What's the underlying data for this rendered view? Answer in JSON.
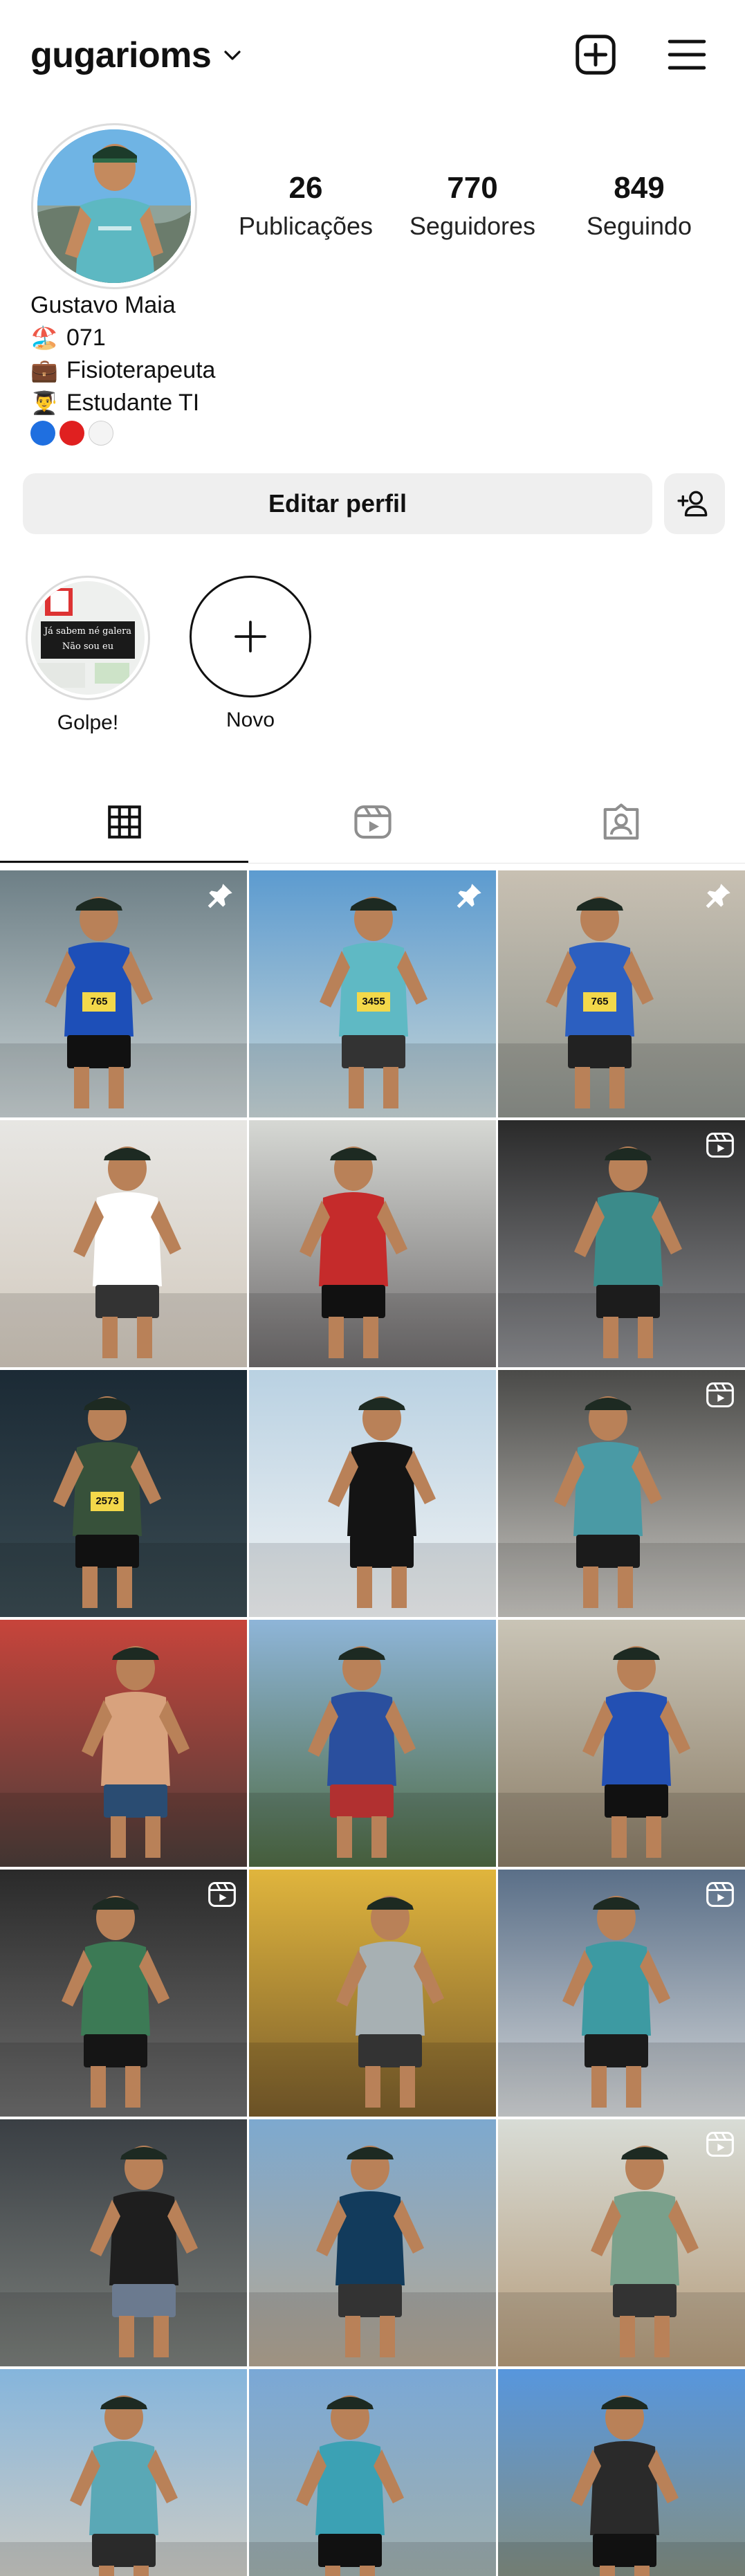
{
  "header": {
    "username": "gugarioms",
    "icons": [
      "chevron-down-icon",
      "new-post-icon",
      "menu-icon"
    ]
  },
  "profile": {
    "stats": [
      {
        "value": "26",
        "label": "Publicações"
      },
      {
        "value": "770",
        "label": "Seguidores"
      },
      {
        "value": "849",
        "label": "Seguindo"
      }
    ],
    "bio": {
      "name": "Gustavo Maia",
      "lines": [
        {
          "emoji": "🏖️",
          "text": "071"
        },
        {
          "emoji": "💼",
          "text": "Fisioterapeuta"
        },
        {
          "emoji": "👨‍🎓",
          "text": "Estudante TI"
        }
      ],
      "dot_colors": [
        "#1f6fe0",
        "#e02020",
        "#f4f4f4"
      ]
    }
  },
  "actions": {
    "edit_profile": "Editar perfil",
    "discover_people_icon": "add-person-icon"
  },
  "highlights": [
    {
      "label": "Golpe!",
      "caption_line1": "Já sabem né galera",
      "caption_line2": "Não sou eu"
    },
    {
      "label": "Novo"
    }
  ],
  "tabs": [
    {
      "name": "grid",
      "icon": "grid-icon",
      "active": true
    },
    {
      "name": "reels",
      "icon": "reels-icon",
      "active": false
    },
    {
      "name": "tagged",
      "icon": "tagged-icon",
      "active": false
    }
  ],
  "posts": [
    {
      "type": "photo",
      "pinned": true,
      "bg": [
        "#6d7f86",
        "#c9d2d4"
      ],
      "shirt": "#1d4fb8",
      "shorts": "#111",
      "bib": "765"
    },
    {
      "type": "photo",
      "pinned": true,
      "bg": [
        "#5c9bd0",
        "#c7d5d6"
      ],
      "shirt": "#5fb9c4",
      "shorts": "#333",
      "bib": "3455"
    },
    {
      "type": "photo",
      "pinned": true,
      "bg": [
        "#c8c0b2",
        "#8f948e"
      ],
      "shirt": "#2c5fc0",
      "shorts": "#222",
      "bib": "765"
    },
    {
      "type": "photo",
      "pinned": false,
      "bg": [
        "#e7e6e3",
        "#d2c9bd"
      ],
      "shirt": "#ffffff",
      "shorts": "#333",
      "bib": ""
    },
    {
      "type": "photo",
      "pinned": false,
      "bg": [
        "#d6d8d4",
        "#6f6c6d"
      ],
      "shirt": "#c52b2b",
      "shorts": "#111",
      "bib": ""
    },
    {
      "type": "reel",
      "pinned": false,
      "bg": [
        "#2a2a2a",
        "#8e8f93"
      ],
      "shirt": "#3b8b8a",
      "shorts": "#1c1c1c",
      "bib": ""
    },
    {
      "type": "photo",
      "pinned": false,
      "bg": [
        "#1b2a35",
        "#3a4b52"
      ],
      "shirt": "#37513a",
      "shorts": "#111",
      "bib": "2573"
    },
    {
      "type": "photo",
      "pinned": false,
      "bg": [
        "#b9d1e2",
        "#f1f3f4"
      ],
      "shirt": "#141414",
      "shorts": "#141414",
      "bib": ""
    },
    {
      "type": "reel",
      "pinned": false,
      "bg": [
        "#4a4a48",
        "#c9c7c2"
      ],
      "shirt": "#4a9aa5",
      "shorts": "#1b1b1b",
      "bib": ""
    },
    {
      "type": "photo",
      "pinned": false,
      "bg": [
        "#c7443b",
        "#4b3d39"
      ],
      "shirt": "#d8a27d",
      "shorts": "#2a4c72",
      "bib": ""
    },
    {
      "type": "photo",
      "pinned": false,
      "bg": [
        "#8eb5d8",
        "#4f6b44"
      ],
      "shirt": "#2a4f9e",
      "shorts": "#b13030",
      "bib": ""
    },
    {
      "type": "photo",
      "pinned": false,
      "bg": [
        "#c9c4b6",
        "#8b7d67"
      ],
      "shirt": "#2350b3",
      "shorts": "#111",
      "bib": ""
    },
    {
      "type": "reel",
      "pinned": false,
      "bg": [
        "#2a2a2a",
        "#6d6d6d"
      ],
      "shirt": "#3c7a55",
      "shorts": "#151515",
      "bib": ""
    },
    {
      "type": "photo",
      "pinned": false,
      "bg": [
        "#e0b53d",
        "#7a5d2c"
      ],
      "shirt": "#a7b0b3",
      "shorts": "#333",
      "bib": ""
    },
    {
      "type": "reel",
      "pinned": false,
      "bg": [
        "#5a6f88",
        "#d3d6d8"
      ],
      "shirt": "#3d9aa2",
      "shorts": "#1b1b1b",
      "bib": ""
    },
    {
      "type": "photo",
      "pinned": false,
      "bg": [
        "#3a3f44",
        "#7a7e7a"
      ],
      "shirt": "#1e1e1e",
      "shorts": "#6b7a8f",
      "bib": ""
    },
    {
      "type": "photo",
      "pinned": false,
      "bg": [
        "#7da9cf",
        "#b5a793"
      ],
      "shirt": "#123b5c",
      "shorts": "#333",
      "bib": ""
    },
    {
      "type": "reel",
      "pinned": false,
      "bg": [
        "#d8dcd6",
        "#b59b7a"
      ],
      "shirt": "#7aa08b",
      "shorts": "#333",
      "bib": ""
    },
    {
      "type": "photo",
      "pinned": false,
      "bg": [
        "#85b5dc",
        "#d9cfc0"
      ],
      "shirt": "#5aa8b6",
      "shorts": "#2a2a2a",
      "bib": ""
    },
    {
      "type": "photo",
      "pinned": false,
      "bg": [
        "#7aa8d6",
        "#a8b1a6"
      ],
      "shirt": "#3ba1b4",
      "shorts": "#111",
      "bib": ""
    },
    {
      "type": "photo",
      "pinned": false,
      "bg": [
        "#5796dd",
        "#8c8e72"
      ],
      "shirt": "#2a2a2a",
      "shorts": "#111",
      "bib": ""
    }
  ]
}
